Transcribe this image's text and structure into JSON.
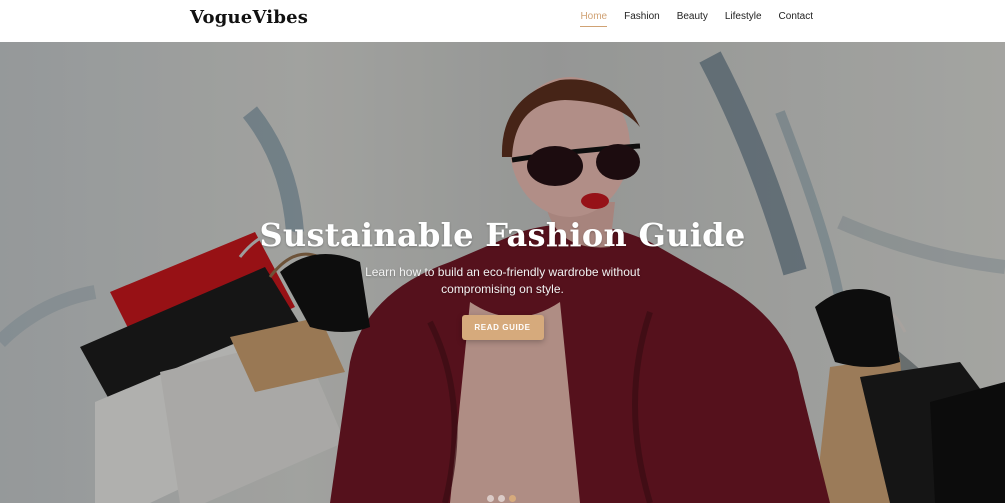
{
  "brand": {
    "name": "VogueVibes"
  },
  "nav": {
    "items": [
      {
        "label": "Home"
      },
      {
        "label": "Fashion"
      },
      {
        "label": "Beauty"
      },
      {
        "label": "Lifestyle"
      },
      {
        "label": "Contact"
      }
    ],
    "active_index": 0
  },
  "hero": {
    "title": "Sustainable Fashion Guide",
    "subtitle": "Learn how to build an eco-friendly wardrobe without compromising on style.",
    "button_label": "READ GUIDE",
    "image_description_label": "hero-image"
  },
  "carousel": {
    "slide_count": 3,
    "active_index": 2
  },
  "theme": {
    "accent": "#d6aa7c",
    "nav_active": "#d0a274",
    "hero_text": "#ffffff"
  }
}
